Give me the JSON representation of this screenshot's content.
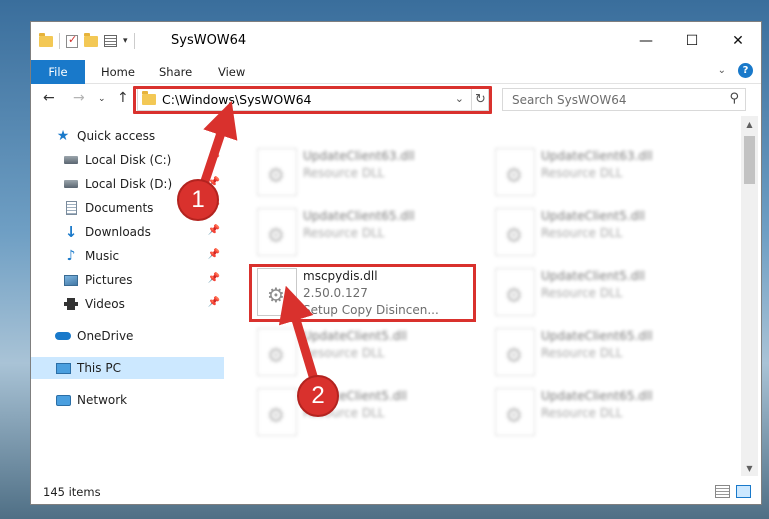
{
  "window": {
    "title": "SysWOW64",
    "controls": [
      "minimize-icon",
      "maximize-icon",
      "close-icon"
    ]
  },
  "ribbon": {
    "file": "File",
    "tabs": [
      "Home",
      "Share",
      "View"
    ],
    "help": "?"
  },
  "address": {
    "path": "C:\\Windows\\SysWOW64",
    "search_placeholder": "Search SysWOW64"
  },
  "navpane": {
    "items": [
      {
        "label": "Quick access",
        "icon": "star-icon"
      },
      {
        "label": "Local Disk (C:)",
        "icon": "drive-icon"
      },
      {
        "label": "Local Disk (D:)",
        "icon": "drive-icon"
      },
      {
        "label": "Documents",
        "icon": "documents-icon"
      },
      {
        "label": "Downloads",
        "icon": "download-icon"
      },
      {
        "label": "Music",
        "icon": "music-icon"
      },
      {
        "label": "Pictures",
        "icon": "pictures-icon"
      },
      {
        "label": "Videos",
        "icon": "videos-icon"
      },
      {
        "label": "OneDrive",
        "icon": "cloud-icon"
      },
      {
        "label": "This PC",
        "icon": "computer-icon"
      },
      {
        "label": "Network",
        "icon": "network-icon"
      }
    ]
  },
  "files": [
    {
      "name": "UpdateClient63.dll",
      "line2": "Resource DLL",
      "line3": ""
    },
    {
      "name": "UpdateClient63.dll",
      "line2": "Resource DLL",
      "line3": ""
    },
    {
      "name": "UpdateClient65.dll",
      "line2": "Resource DLL",
      "line3": ""
    },
    {
      "name": "UpdateClient5.dll",
      "line2": "Resource DLL",
      "line3": ""
    },
    {
      "name": "mscpydis.dll",
      "line2": "2.50.0.127",
      "line3": "Setup Copy Disincen..."
    },
    {
      "name": "UpdateClient5.dll",
      "line2": "Resource DLL",
      "line3": ""
    },
    {
      "name": "UpdateClient5.dll",
      "line2": "Resource DLL",
      "line3": ""
    },
    {
      "name": "UpdateClient65.dll",
      "line2": "Resource DLL",
      "line3": ""
    },
    {
      "name": "UpdateClient5.dll",
      "line2": "Resource DLL",
      "line3": ""
    },
    {
      "name": "UpdateClient65.dll",
      "line2": "Resource DLL",
      "line3": ""
    }
  ],
  "status": {
    "count": "145 items"
  },
  "annotations": {
    "step1": "1",
    "step2": "2",
    "color": "#d9312d"
  }
}
